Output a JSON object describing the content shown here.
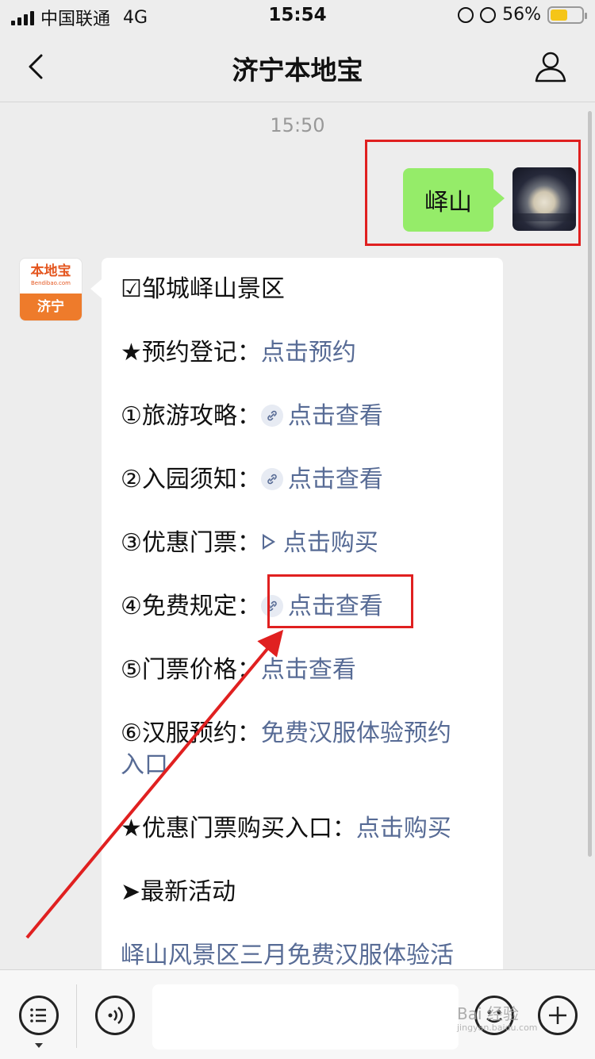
{
  "status": {
    "carrier": "中国联通",
    "network": "4G",
    "time": "15:54",
    "battery_percent": "56%",
    "battery_level": 0.56
  },
  "nav": {
    "title": "济宁本地宝"
  },
  "chat": {
    "timestamp": "15:50",
    "sent_message": "峄山",
    "bot_avatar": {
      "brand": "本地宝",
      "sub": "Bendibao.com",
      "city": "济宁"
    },
    "reply": {
      "heading": "☑邹城峄山景区",
      "lines": [
        {
          "prefix": "★预约登记：",
          "link": "点击预约",
          "icon": "none"
        },
        {
          "prefix": "①旅游攻略：",
          "link": "点击查看",
          "icon": "link-icon"
        },
        {
          "prefix": "②入园须知：",
          "link": "点击查看",
          "icon": "link-icon"
        },
        {
          "prefix": "③优惠门票：",
          "link": "点击购买",
          "icon": "play-icon"
        },
        {
          "prefix": "④免费规定：",
          "link": "点击查看",
          "icon": "link-icon"
        },
        {
          "prefix": "⑤门票价格：",
          "link": "点击查看",
          "icon": "none"
        },
        {
          "prefix": "⑥汉服预约：",
          "link": "免费汉服体验预约",
          "link_cont": "入口",
          "icon": "none"
        },
        {
          "prefix": "★优惠门票购买入口：",
          "link": "点击购买",
          "icon": "none"
        }
      ],
      "activity_heading": "➤最新活动",
      "activity_link": "峄山风景区三月免费汉服体验活"
    }
  },
  "toolbar": {
    "input_value": ""
  },
  "watermark": {
    "text": "Bai 经验",
    "sub": "jingyan.baidu.com"
  },
  "colors": {
    "link": "#576b95",
    "sent_bubble": "#95ec69",
    "annotation": "#e02020"
  }
}
